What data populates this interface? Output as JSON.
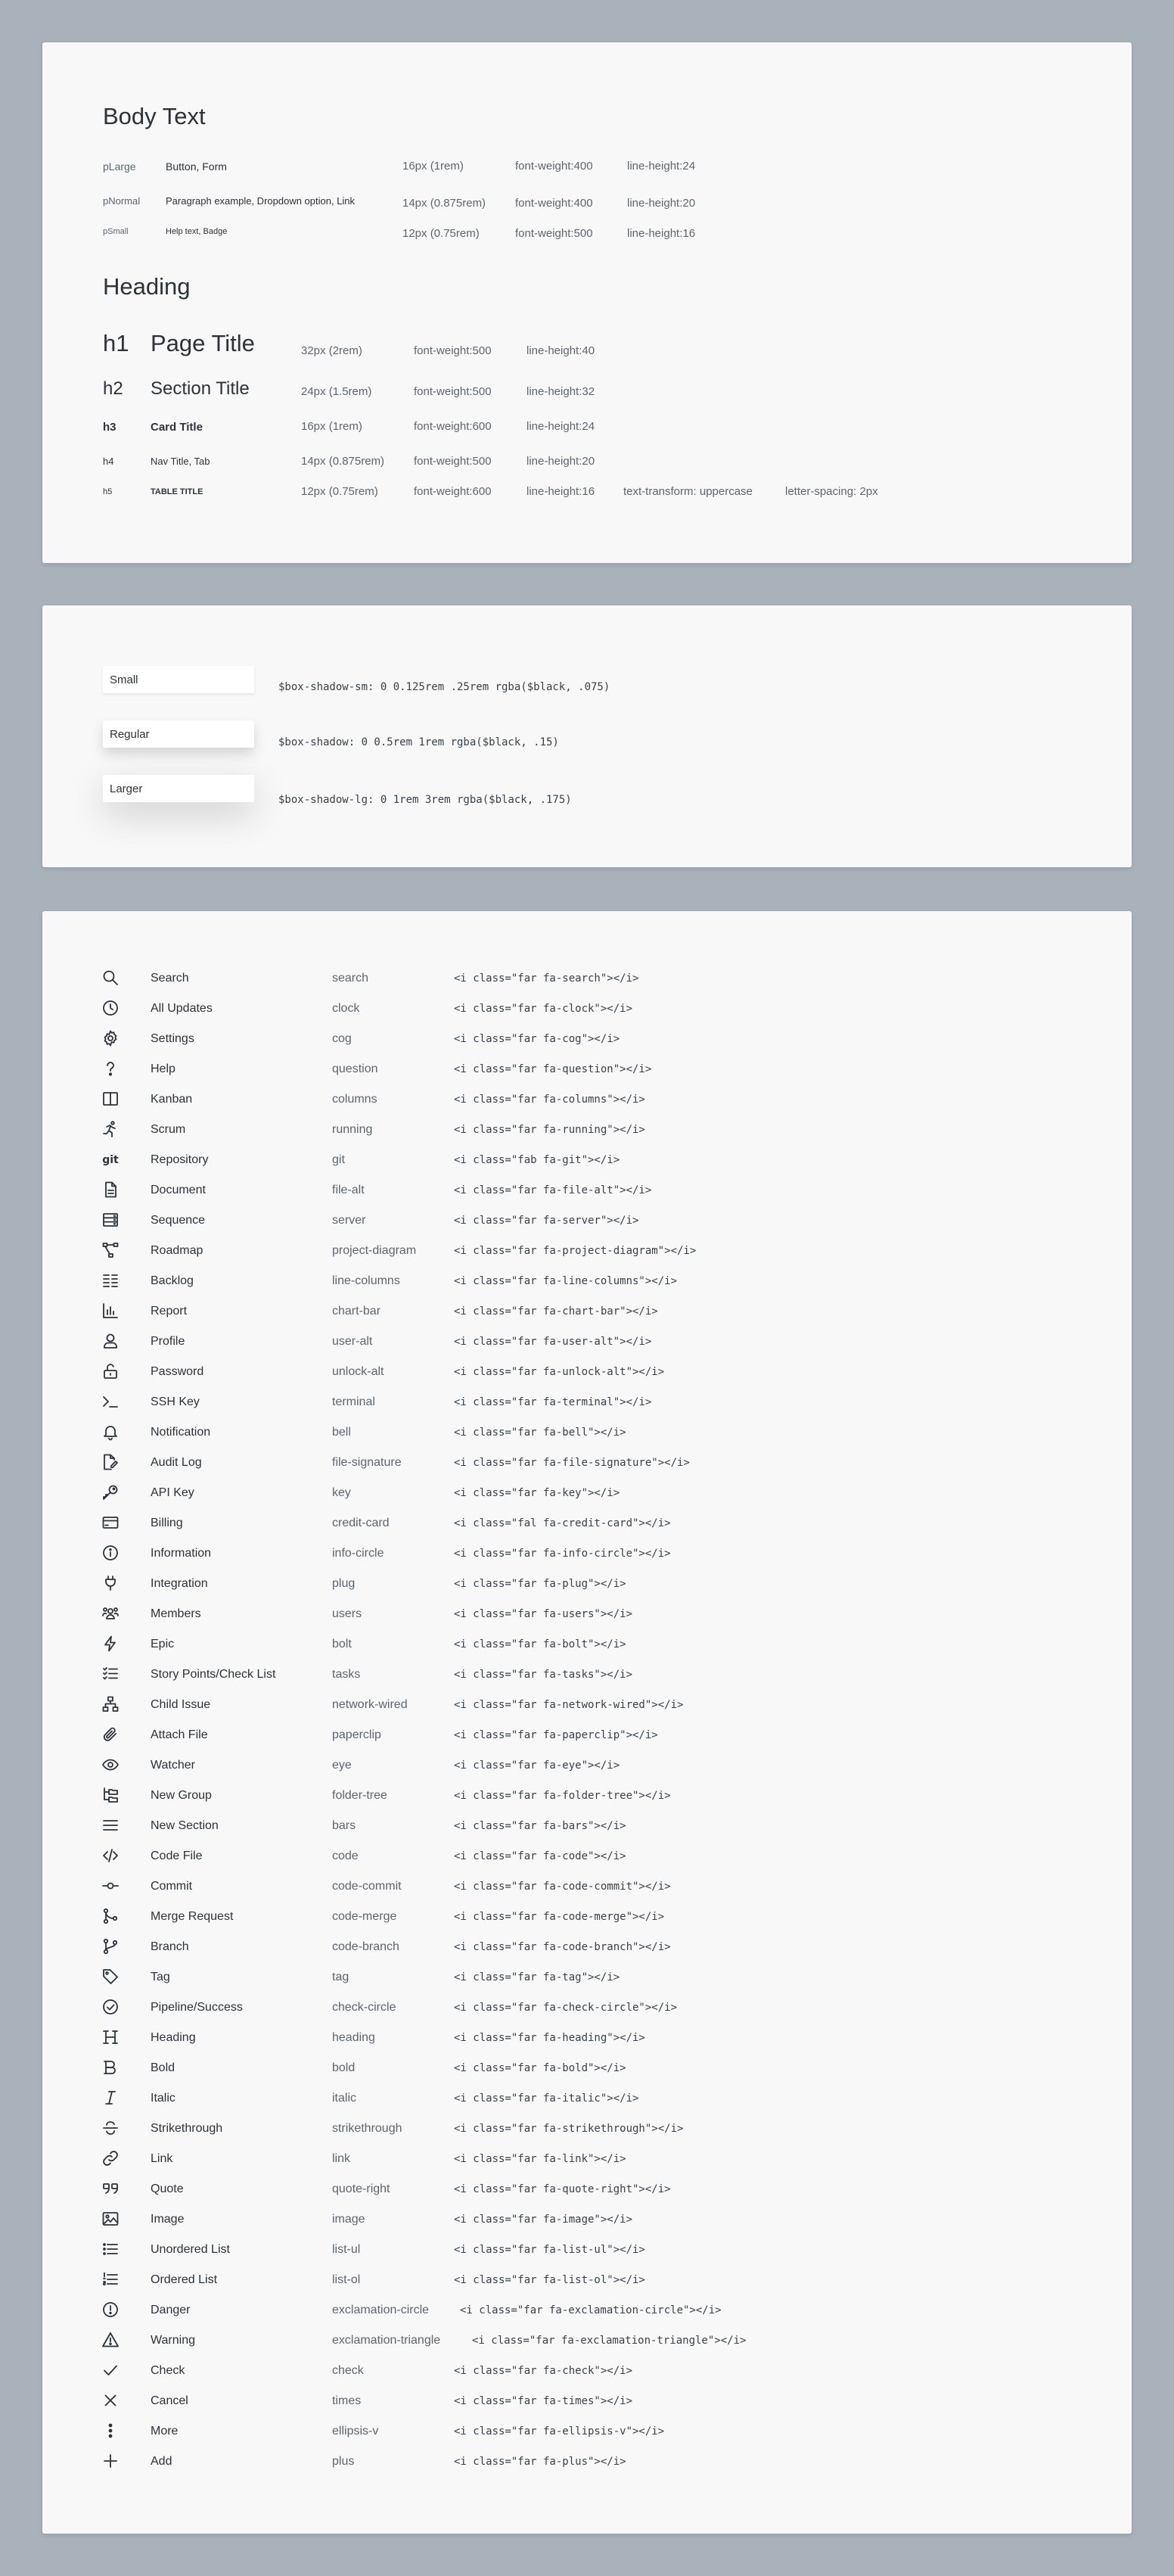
{
  "typography": {
    "body_title": "Body Text",
    "body_rows": [
      {
        "tag": "pLarge",
        "example": "Button, Form",
        "size": "16px (1rem)",
        "weight": "font-weight:400",
        "line_height": "line-height:24"
      },
      {
        "tag": "pNormal",
        "example": "Paragraph example, Dropdown option, Link",
        "size": "14px (0.875rem)",
        "weight": "font-weight:400",
        "line_height": "line-height:20"
      },
      {
        "tag": "pSmall",
        "example": "Help text, Badge",
        "size": "12px (0.75rem)",
        "weight": "font-weight:500",
        "line_height": "line-height:16"
      }
    ],
    "heading_title": "Heading",
    "heading_rows": [
      {
        "tag": "h1",
        "example": "Page Title",
        "size": "32px (2rem)",
        "weight": "font-weight:500",
        "line_height": "line-height:40"
      },
      {
        "tag": "h2",
        "example": "Section Title",
        "size": "24px (1.5rem)",
        "weight": "font-weight:500",
        "line_height": "line-height:32"
      },
      {
        "tag": "h3",
        "example": "Card Title",
        "size": "16px (1rem)",
        "weight": "font-weight:600",
        "line_height": "line-height:24"
      },
      {
        "tag": "h4",
        "example": "Nav Title, Tab",
        "size": "14px (0.875rem)",
        "weight": "font-weight:500",
        "line_height": "line-height:20"
      },
      {
        "tag": "h5",
        "example": "TABLE TITLE",
        "size": "12px (0.75rem)",
        "weight": "font-weight:600",
        "line_height": "line-height:16",
        "transform": "text-transform: uppercase",
        "spacing": "letter-spacing: 2px"
      }
    ]
  },
  "shadows": [
    {
      "label": "Small",
      "code": "$box-shadow-sm: 0 0.125rem .25rem rgba($black, .075)"
    },
    {
      "label": "Regular",
      "code": "$box-shadow: 0 0.5rem 1rem rgba($black, .15)"
    },
    {
      "label": "Larger",
      "code": "$box-shadow-lg: 0 1rem 3rem rgba($black, .175)"
    }
  ],
  "icons": [
    {
      "label": "Search",
      "name": "search",
      "code": "<i class=\"far fa-search\"></i>",
      "icon": "search-icon"
    },
    {
      "label": "All Updates",
      "name": "clock",
      "code": "<i class=\"far fa-clock\"></i>",
      "icon": "clock-icon"
    },
    {
      "label": "Settings",
      "name": "cog",
      "code": "<i class=\"far fa-cog\"></i>",
      "icon": "cog-icon"
    },
    {
      "label": "Help",
      "name": "question",
      "code": "<i class=\"far fa-question\"></i>",
      "icon": "question-icon"
    },
    {
      "label": "Kanban",
      "name": "columns",
      "code": "<i class=\"far fa-columns\"></i>",
      "icon": "columns-icon"
    },
    {
      "label": "Scrum",
      "name": "running",
      "code": "<i class=\"far fa-running\"></i>",
      "icon": "running-icon"
    },
    {
      "label": "Repository",
      "name": "git",
      "code": "<i class=\"fab fa-git\"></i>",
      "icon": "git-icon"
    },
    {
      "label": "Document",
      "name": "file-alt",
      "code": "<i class=\"far fa-file-alt\"></i>",
      "icon": "file-alt-icon"
    },
    {
      "label": "Sequence",
      "name": "server",
      "code": "<i class=\"far fa-server\"></i>",
      "icon": "server-icon"
    },
    {
      "label": "Roadmap",
      "name": "project-diagram",
      "code": "<i class=\"far fa-project-diagram\"></i>",
      "icon": "project-diagram-icon"
    },
    {
      "label": "Backlog",
      "name": "line-columns",
      "code": "<i class=\"far fa-line-columns\"></i>",
      "icon": "line-columns-icon"
    },
    {
      "label": "Report",
      "name": "chart-bar",
      "code": "<i class=\"far fa-chart-bar\"></i>",
      "icon": "chart-bar-icon"
    },
    {
      "label": "Profile",
      "name": "user-alt",
      "code": "<i class=\"far fa-user-alt\"></i>",
      "icon": "user-alt-icon"
    },
    {
      "label": "Password",
      "name": "unlock-alt",
      "code": "<i class=\"far fa-unlock-alt\"></i>",
      "icon": "unlock-alt-icon"
    },
    {
      "label": "SSH Key",
      "name": "terminal",
      "code": "<i class=\"far fa-terminal\"></i>",
      "icon": "terminal-icon"
    },
    {
      "label": "Notification",
      "name": "bell",
      "code": "<i class=\"far fa-bell\"></i>",
      "icon": "bell-icon"
    },
    {
      "label": "Audit Log",
      "name": "file-signature",
      "code": "<i class=\"far fa-file-signature\"></i>",
      "icon": "file-signature-icon"
    },
    {
      "label": "API Key",
      "name": "key",
      "code": "<i class=\"far fa-key\"></i>",
      "icon": "key-icon"
    },
    {
      "label": "Billing",
      "name": "credit-card",
      "code": "<i class=\"fal fa-credit-card\"></i>",
      "icon": "credit-card-icon"
    },
    {
      "label": "Information",
      "name": "info-circle",
      "code": "<i class=\"far fa-info-circle\"></i>",
      "icon": "info-circle-icon"
    },
    {
      "label": "Integration",
      "name": "plug",
      "code": "<i class=\"far fa-plug\"></i>",
      "icon": "plug-icon"
    },
    {
      "label": "Members",
      "name": "users",
      "code": "<i class=\"far fa-users\"></i>",
      "icon": "users-icon"
    },
    {
      "label": "Epic",
      "name": "bolt",
      "code": "<i class=\"far fa-bolt\"></i>",
      "icon": "bolt-icon"
    },
    {
      "label": "Story Points/Check List",
      "name": "tasks",
      "code": "<i class=\"far fa-tasks\"></i>",
      "icon": "tasks-icon"
    },
    {
      "label": "Child Issue",
      "name": "network-wired",
      "code": "<i class=\"far fa-network-wired\"></i>",
      "icon": "network-wired-icon"
    },
    {
      "label": "Attach File",
      "name": "paperclip",
      "code": "<i class=\"far fa-paperclip\"></i>",
      "icon": "paperclip-icon"
    },
    {
      "label": "Watcher",
      "name": "eye",
      "code": "<i class=\"far fa-eye\"></i>",
      "icon": "eye-icon"
    },
    {
      "label": "New Group",
      "name": "folder-tree",
      "code": "<i class=\"far fa-folder-tree\"></i>",
      "icon": "folder-tree-icon"
    },
    {
      "label": "New Section",
      "name": "bars",
      "code": "<i class=\"far fa-bars\"></i>",
      "icon": "bars-icon"
    },
    {
      "label": "Code File",
      "name": "code",
      "code": "<i class=\"far fa-code\"></i>",
      "icon": "code-icon"
    },
    {
      "label": "Commit",
      "name": "code-commit",
      "code": "<i class=\"far fa-code-commit\"></i>",
      "icon": "code-commit-icon"
    },
    {
      "label": "Merge Request",
      "name": "code-merge",
      "code": "<i class=\"far fa-code-merge\"></i>",
      "icon": "code-merge-icon"
    },
    {
      "label": "Branch",
      "name": "code-branch",
      "code": "<i class=\"far fa-code-branch\"></i>",
      "icon": "code-branch-icon"
    },
    {
      "label": "Tag",
      "name": "tag",
      "code": "<i class=\"far fa-tag\"></i>",
      "icon": "tag-icon"
    },
    {
      "label": "Pipeline/Success",
      "name": "check-circle",
      "code": "<i class=\"far fa-check-circle\"></i>",
      "icon": "check-circle-icon"
    },
    {
      "label": "Heading",
      "name": "heading",
      "code": "<i class=\"far fa-heading\"></i>",
      "icon": "heading-icon"
    },
    {
      "label": "Bold",
      "name": "bold",
      "code": "<i class=\"far fa-bold\"></i>",
      "icon": "bold-icon"
    },
    {
      "label": "Italic",
      "name": "italic",
      "code": "<i class=\"far fa-italic\"></i>",
      "icon": "italic-icon"
    },
    {
      "label": "Strikethrough",
      "name": "strikethrough",
      "code": "<i class=\"far fa-strikethrough\"></i>",
      "icon": "strikethrough-icon"
    },
    {
      "label": "Link",
      "name": "link",
      "code": "<i class=\"far fa-link\"></i>",
      "icon": "link-icon"
    },
    {
      "label": "Quote",
      "name": "quote-right",
      "code": "<i class=\"far fa-quote-right\"></i>",
      "icon": "quote-right-icon"
    },
    {
      "label": "Image",
      "name": "image",
      "code": "<i class=\"far fa-image\"></i>",
      "icon": "image-icon"
    },
    {
      "label": "Unordered List",
      "name": "list-ul",
      "code": "<i class=\"far fa-list-ul\"></i>",
      "icon": "list-ul-icon"
    },
    {
      "label": "Ordered List",
      "name": "list-ol",
      "code": "<i class=\"far fa-list-ol\"></i>",
      "icon": "list-ol-icon"
    },
    {
      "label": "Danger",
      "name": "exclamation-circle",
      "code": "<i class=\"far fa-exclamation-circle\"></i>",
      "icon": "exclamation-circle-icon"
    },
    {
      "label": "Warning",
      "name": "exclamation-triangle",
      "code": "<i class=\"far fa-exclamation-triangle\"></i>",
      "icon": "exclamation-triangle-icon"
    },
    {
      "label": "Check",
      "name": "check",
      "code": "<i class=\"far fa-check\"></i>",
      "icon": "check-icon"
    },
    {
      "label": "Cancel",
      "name": "times",
      "code": "<i class=\"far fa-times\"></i>",
      "icon": "times-icon"
    },
    {
      "label": "More",
      "name": "ellipsis-v",
      "code": "<i class=\"far fa-ellipsis-v\"></i>",
      "icon": "ellipsis-v-icon"
    },
    {
      "label": "Add",
      "name": "plus",
      "code": "<i class=\"far fa-plus\"></i>",
      "icon": "plus-icon"
    }
  ]
}
